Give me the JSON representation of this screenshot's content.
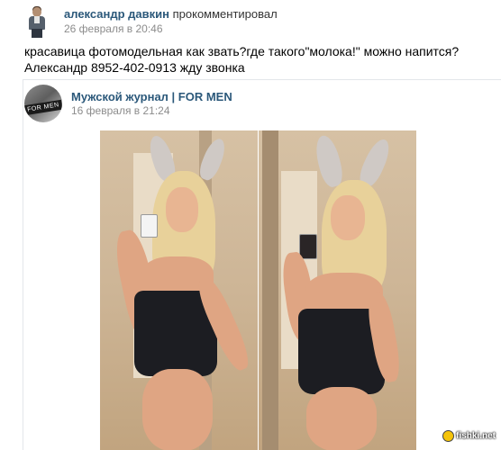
{
  "comment": {
    "author": "александр давкин",
    "action": "прокомментировал",
    "date": "26 февраля в 20:46",
    "text": "красавица фотомодельная как звать?где такого\"молока!\" можно напится?Александр 8952-402-0913 жду звонка"
  },
  "post": {
    "group_name": "Мужской журнал | FOR MEN",
    "group_avatar_text": "FOR MEN",
    "date": "16 февраля в 21:24",
    "photos": [
      {
        "icon": "photo-left"
      },
      {
        "icon": "photo-right"
      }
    ]
  },
  "watermark": {
    "text": "fishki.net"
  }
}
